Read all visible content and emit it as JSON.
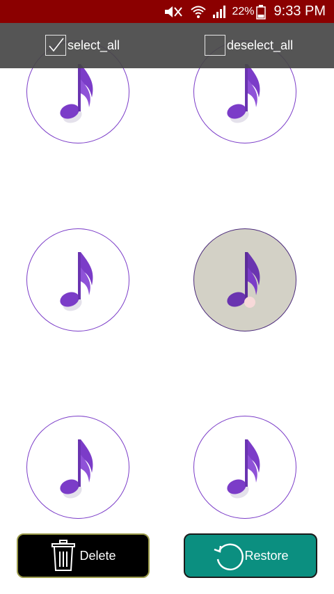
{
  "status_bar": {
    "battery_percent": "22%",
    "time": "9:33 PM",
    "icons": [
      "mute-icon",
      "wifi-icon",
      "signal-icon",
      "battery-icon"
    ]
  },
  "toolbar": {
    "select_all_label": "select_all",
    "select_all_checked": true,
    "deselect_all_label": "deselect_all",
    "deselect_all_checked": false
  },
  "tiles": [
    {
      "icon": "music-note-icon",
      "selected": false
    },
    {
      "icon": "music-note-icon",
      "selected": false
    },
    {
      "icon": "music-note-icon",
      "selected": false
    },
    {
      "icon": "music-note-icon",
      "selected": true
    },
    {
      "icon": "music-note-icon",
      "selected": false
    },
    {
      "icon": "music-note-icon",
      "selected": false
    }
  ],
  "actions": {
    "delete_label": "Delete",
    "restore_label": "Restore"
  },
  "colors": {
    "status_bar": "#8b0000",
    "toolbar": "#464646",
    "note_purple": "#7b3cc8",
    "selected_tile": "#d3d1c6",
    "restore_button": "#0b8f80",
    "delete_button": "#000000"
  }
}
